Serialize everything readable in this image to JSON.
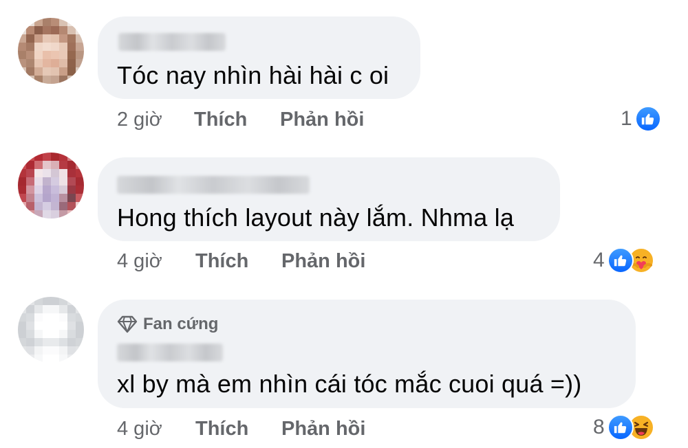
{
  "comments": [
    {
      "text": "Tóc nay nhìn hài hài c oi",
      "time": "2 giờ",
      "like_label": "Thích",
      "reply_label": "Phản hồi",
      "reaction_count": "1",
      "reactions": [
        "like-icon"
      ]
    },
    {
      "text": "Hong thích layout này lắm. Nhma lạ",
      "time": "4 giờ",
      "like_label": "Thích",
      "reply_label": "Phản hồi",
      "reaction_count": "4",
      "reactions": [
        "like-icon",
        "care-icon"
      ]
    },
    {
      "badge": "Fan cứng",
      "text": "xl by mà em nhìn cái tóc mắc cuoi quá =))",
      "time": "4 giờ",
      "like_label": "Thích",
      "reply_label": "Phản hồi",
      "reaction_count": "8",
      "reactions": [
        "like-icon",
        "haha-icon"
      ]
    }
  ],
  "colors": {
    "bubble": "#f0f2f5",
    "meta_text": "#65676b",
    "like_blue": "#0866ff",
    "emoji_yellow": "#f7b125"
  }
}
